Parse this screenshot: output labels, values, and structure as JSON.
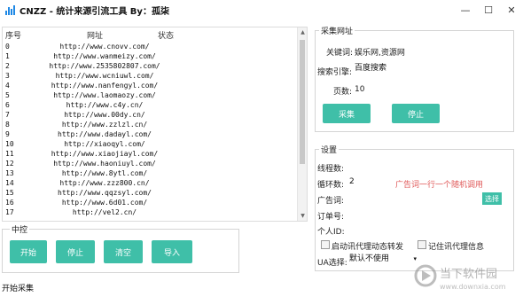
{
  "window": {
    "title": "CNZZ - 统计来源引流工具 By：孤柒",
    "min_glyph": "—",
    "max_glyph": "☐",
    "close_glyph": "✕"
  },
  "list": {
    "headers": {
      "index": "序号",
      "url": "网址",
      "status": "状态"
    },
    "rows": [
      {
        "idx": "0",
        "url": "http://www.cnovv.com/"
      },
      {
        "idx": "1",
        "url": "http://www.wanmeizy.com/"
      },
      {
        "idx": "2",
        "url": "http://www.2535802807.com/"
      },
      {
        "idx": "3",
        "url": "http://www.wcniuwl.com/"
      },
      {
        "idx": "4",
        "url": "http://www.nanfengyl.com/"
      },
      {
        "idx": "5",
        "url": "http://www.laomaozy.com/"
      },
      {
        "idx": "6",
        "url": "http://www.c4y.cn/"
      },
      {
        "idx": "7",
        "url": "http://www.00dy.cn/"
      },
      {
        "idx": "8",
        "url": "http://www.zzlzl.cn/"
      },
      {
        "idx": "9",
        "url": "http://www.dadayl.com/"
      },
      {
        "idx": "10",
        "url": "http://xiaoqyl.com/"
      },
      {
        "idx": "11",
        "url": "http://www.xiaojiayl.com/"
      },
      {
        "idx": "12",
        "url": "http://www.haoniuyl.com/"
      },
      {
        "idx": "13",
        "url": "http://www.8ytl.com/"
      },
      {
        "idx": "14",
        "url": "http://www.zzz800.cn/"
      },
      {
        "idx": "15",
        "url": "http://www.qqzsyl.com/"
      },
      {
        "idx": "16",
        "url": "http://www.6d01.com/"
      },
      {
        "idx": "17",
        "url": "http://vel2.cn/"
      }
    ],
    "scroll_up": "▲",
    "scroll_down": "▼"
  },
  "control": {
    "legend": "中控",
    "start": "开始",
    "stop": "停止",
    "clear": "清空",
    "import": "导入"
  },
  "collect": {
    "legend": "采集网址",
    "keyword_label": "关键词:",
    "keyword_value": "娱乐网,资源网",
    "engine_label": "搜索引擎:",
    "engine_value": "百度搜索",
    "pages_label": "页数:",
    "pages_value": "10",
    "collect_btn": "采集",
    "stop_btn": "停止"
  },
  "settings": {
    "legend": "设置",
    "threads_label": "线程数:",
    "threads_value": "",
    "loops_label": "循环数:",
    "loops_value": "2",
    "ad_hint": "广告词一行一个随机调用",
    "ad_label": "广告词:",
    "ad_value": "",
    "choose_btn": "选择",
    "order_label": "订单号:",
    "order_value": "",
    "personal_label": "个人ID:",
    "personal_value": "",
    "proxy_dynamic_label": "启动讯代理动态转发",
    "remember_proxy_label": "记住讯代理信息",
    "ua_label": "UA选择:",
    "ua_value": "默认不使用"
  },
  "status": {
    "text": "开始采集"
  },
  "watermark": {
    "line1": "当下软件园",
    "line2": "www.downxia.com"
  },
  "colors": {
    "accent": "#3fbfa8",
    "hint": "#e05a5a"
  }
}
